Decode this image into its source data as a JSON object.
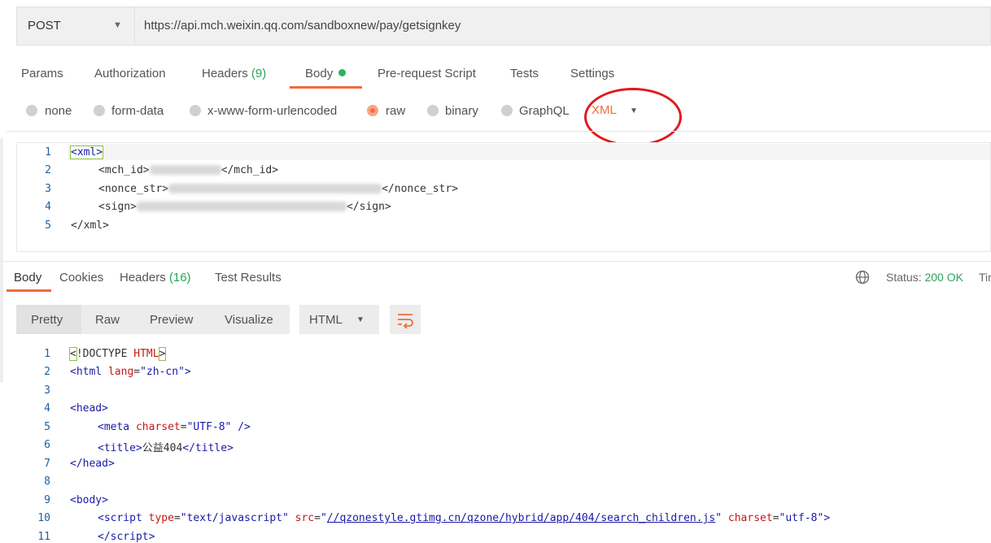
{
  "request": {
    "method": "POST",
    "url": "https://api.mch.weixin.qq.com/sandboxnew/pay/getsignkey",
    "tabs": [
      "Params",
      "Authorization",
      "Headers",
      "Body",
      "Pre-request Script",
      "Tests",
      "Settings"
    ],
    "headers_count": "(9)",
    "active_tab": "Body",
    "body_modes": [
      "none",
      "form-data",
      "x-www-form-urlencoded",
      "raw",
      "binary",
      "GraphQL"
    ],
    "selected_mode": "raw",
    "raw_language": "XML",
    "body_lines": [
      {
        "n": "1",
        "pre": "",
        "open": "<xml>",
        "value": "",
        "close": ""
      },
      {
        "n": "2",
        "pre": "    ",
        "open": "<mch_id>",
        "value": "",
        "close": "</mch_id>"
      },
      {
        "n": "3",
        "pre": "    ",
        "open": "<nonce_str>",
        "value": "",
        "close": "</nonce_str>"
      },
      {
        "n": "4",
        "pre": "    ",
        "open": "<sign>",
        "value": "",
        "close": "</sign>"
      },
      {
        "n": "5",
        "pre": "",
        "open": "</xml>",
        "value": "",
        "close": ""
      }
    ]
  },
  "response": {
    "tabs": [
      "Body",
      "Cookies",
      "Headers",
      "Test Results"
    ],
    "headers_count": "(16)",
    "status_label": "Status:",
    "status_value": "200 OK",
    "status_trailing": "Tir",
    "views": [
      "Pretty",
      "Raw",
      "Preview",
      "Visualize"
    ],
    "format": "HTML",
    "line_numbers": [
      "1",
      "2",
      "3",
      "4",
      "5",
      "6",
      "7",
      "8",
      "9",
      "10",
      "11"
    ]
  },
  "colors": {
    "accent": "#f26b3a",
    "success": "#26a55b",
    "annotation_ring": "#e01b1b"
  },
  "icons": [
    "chevron-down-icon",
    "globe-icon",
    "wrap-lines-icon"
  ]
}
